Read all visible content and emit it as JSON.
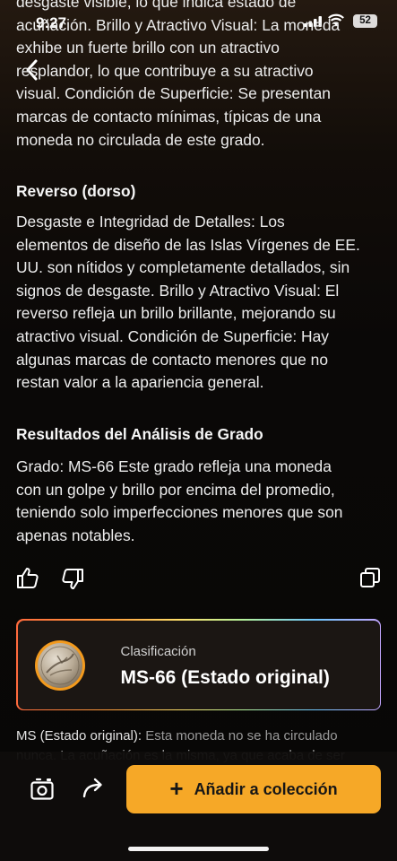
{
  "status_bar": {
    "time": "9:27",
    "battery": "52"
  },
  "content": {
    "obverse_tail_lines": [
      "desgaste visible, lo que indica estado de",
      "acuñación. Brillo y Atractivo Visual: La moneda",
      "exhibe un fuerte brillo con un atractivo",
      "resplandor, lo que contribuye a su atractivo",
      "visual. Condición de Superficie: Se presentan",
      "marcas de contacto mínimas, típicas de una",
      "moneda no circulada de este grado."
    ],
    "reverse_heading": "Reverso (dorso)",
    "reverse_lines": [
      "Desgaste e Integridad de Detalles: Los",
      "elementos de diseño de las Islas Vírgenes de EE.",
      "UU. son nítidos y completamente detallados, sin",
      "signos de desgaste. Brillo y Atractivo Visual: El",
      "reverso refleja un brillo brillante, mejorando su",
      "atractivo visual. Condición de Superficie: Hay",
      "algunas marcas de contacto menores que no",
      "restan valor a la apariencia general."
    ],
    "results_heading": "Resultados del Análisis de Grado",
    "results_lines": [
      "Grado: MS-66 Este grado refleja una moneda",
      "con un golpe y brillo por encima del promedio,",
      "teniendo solo imperfecciones menores que son",
      "apenas notables."
    ]
  },
  "grade_card": {
    "label": "Clasificación",
    "value": "MS-66 (Estado original)"
  },
  "ms_note": {
    "term": "MS (Estado original):",
    "text": "Esta moneda no se ha circulado",
    "cut_line": "nunca. La acuñación es la misma, ya que acaba de ser"
  },
  "bottom_bar": {
    "add_label": "Añadir a colección",
    "add_symbol": "+"
  }
}
